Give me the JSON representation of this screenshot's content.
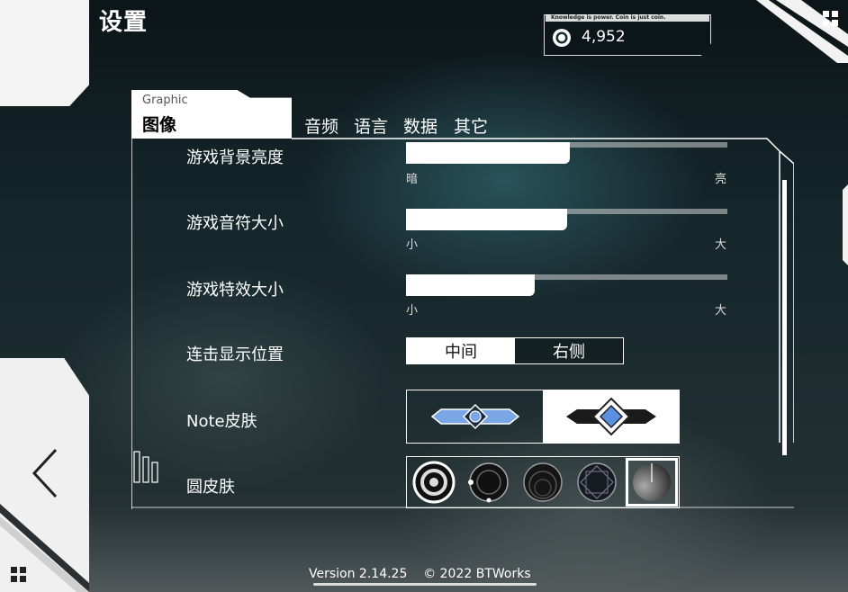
{
  "header": {
    "title": "设置"
  },
  "coin": {
    "tagline": "Knowledge is power. Coin is just coin.",
    "value": "4,952"
  },
  "tabs": {
    "active": {
      "english": "Graphic",
      "label": "图像"
    },
    "others": [
      "音频",
      "语言",
      "数据",
      "其它"
    ]
  },
  "settings": {
    "brightness": {
      "label": "游戏背景亮度",
      "min": "暗",
      "max": "亮",
      "value_fraction": 0.51
    },
    "note_size": {
      "label": "游戏音符大小",
      "min": "小",
      "max": "大",
      "value_fraction": 0.5
    },
    "effect_size": {
      "label": "游戏特效大小",
      "min": "小",
      "max": "大",
      "value_fraction": 0.4
    },
    "combo_position": {
      "label": "连击显示位置",
      "options": [
        "中间",
        "右侧"
      ],
      "selected": "中间"
    },
    "note_skin": {
      "label": "Note皮肤",
      "selected_index": 1
    },
    "circle_skin": {
      "label": "圆皮肤",
      "selected_index": 4
    }
  },
  "footer": {
    "version": "Version 2.14.25",
    "copyright": "© 2022 BTWorks"
  },
  "colors": {
    "accent": "#6f9bd8",
    "panel_border": "#ffffff"
  }
}
